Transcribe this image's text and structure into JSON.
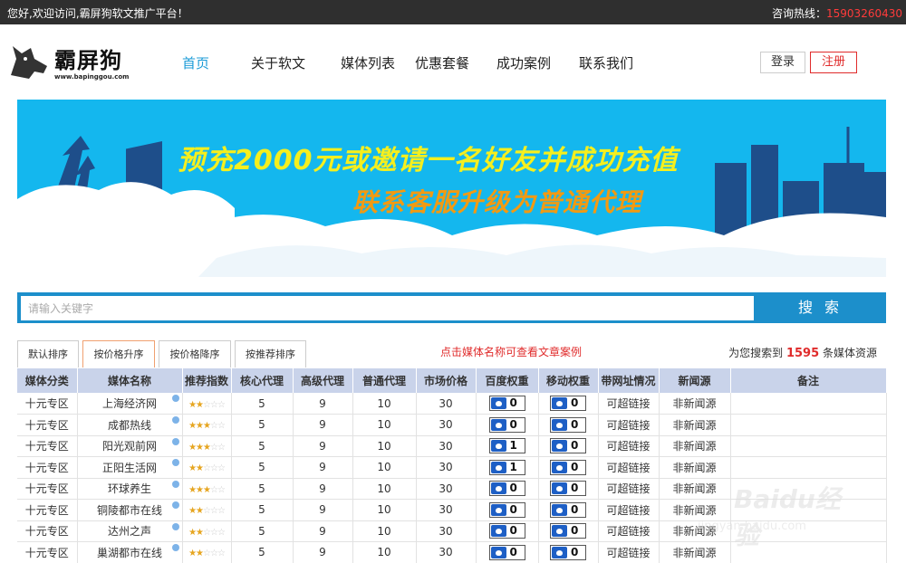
{
  "topbar": {
    "welcome": "您好,欢迎访问,霸屏狗软文推广平台！",
    "hotline_label": "咨询热线：",
    "hotline_number": "15903260430"
  },
  "logo": {
    "brand": "霸屏狗",
    "domain": "www.bapinggou.com"
  },
  "nav": [
    {
      "label": "首页",
      "active": true
    },
    {
      "label": "关于软文",
      "active": false
    },
    {
      "label": "媒体列表",
      "active": false
    },
    {
      "label": "优惠套餐",
      "active": false
    },
    {
      "label": "成功案例",
      "active": false
    },
    {
      "label": "联系我们",
      "active": false
    }
  ],
  "auth": {
    "login": "登录",
    "register": "注册"
  },
  "banner": {
    "line1": "预充2000元或邀请一名好友并成功充值",
    "line2": "联系客服升级为普通代理"
  },
  "search": {
    "placeholder": "请输入关键字",
    "button": "搜 索"
  },
  "sort": {
    "buttons": [
      "默认排序",
      "按价格升序",
      "按价格降序",
      "按推荐排序"
    ],
    "hint": "点击媒体名称可查看文章案例",
    "count_prefix": "为您搜索到",
    "count": "1595",
    "count_suffix": "条媒体资源"
  },
  "table": {
    "headers": [
      "媒体分类",
      "媒体名称",
      "推荐指数",
      "核心代理",
      "高级代理",
      "普通代理",
      "市场价格",
      "百度权重",
      "移动权重",
      "带网址情况",
      "新闻源",
      "备注"
    ],
    "rows": [
      {
        "category": "十元专区",
        "name": "上海经济网",
        "stars": 2,
        "core": "5",
        "senior": "9",
        "normal": "10",
        "market": "30",
        "baidu": "0",
        "mobile": "0",
        "link": "可超链接",
        "news": "非新闻源",
        "note": ""
      },
      {
        "category": "十元专区",
        "name": "成都热线",
        "stars": 3,
        "core": "5",
        "senior": "9",
        "normal": "10",
        "market": "30",
        "baidu": "0",
        "mobile": "0",
        "link": "可超链接",
        "news": "非新闻源",
        "note": ""
      },
      {
        "category": "十元专区",
        "name": "阳光观前网",
        "stars": 3,
        "core": "5",
        "senior": "9",
        "normal": "10",
        "market": "30",
        "baidu": "1",
        "mobile": "0",
        "link": "可超链接",
        "news": "非新闻源",
        "note": ""
      },
      {
        "category": "十元专区",
        "name": "正阳生活网",
        "stars": 2,
        "core": "5",
        "senior": "9",
        "normal": "10",
        "market": "30",
        "baidu": "1",
        "mobile": "0",
        "link": "可超链接",
        "news": "非新闻源",
        "note": ""
      },
      {
        "category": "十元专区",
        "name": "环球养生",
        "stars": 3,
        "core": "5",
        "senior": "9",
        "normal": "10",
        "market": "30",
        "baidu": "0",
        "mobile": "0",
        "link": "可超链接",
        "news": "非新闻源",
        "note": ""
      },
      {
        "category": "十元专区",
        "name": "铜陵都市在线",
        "stars": 2,
        "core": "5",
        "senior": "9",
        "normal": "10",
        "market": "30",
        "baidu": "0",
        "mobile": "0",
        "link": "可超链接",
        "news": "非新闻源",
        "note": ""
      },
      {
        "category": "十元专区",
        "name": "达州之声",
        "stars": 2,
        "core": "5",
        "senior": "9",
        "normal": "10",
        "market": "30",
        "baidu": "0",
        "mobile": "0",
        "link": "可超链接",
        "news": "非新闻源",
        "note": ""
      },
      {
        "category": "十元专区",
        "name": "巢湖都市在线",
        "stars": 2,
        "core": "5",
        "senior": "9",
        "normal": "10",
        "market": "30",
        "baidu": "0",
        "mobile": "0",
        "link": "可超链接",
        "news": "非新闻源",
        "note": ""
      }
    ]
  },
  "watermark": {
    "text1": "Baidu经验",
    "text2": "jingyan.baidu.com"
  },
  "colors": {
    "accent": "#1b9bd7",
    "danger": "#e02b2b",
    "topbar": "#2f2f2f",
    "banner": "#14b7ee",
    "table_header": "#c9d3ea"
  }
}
